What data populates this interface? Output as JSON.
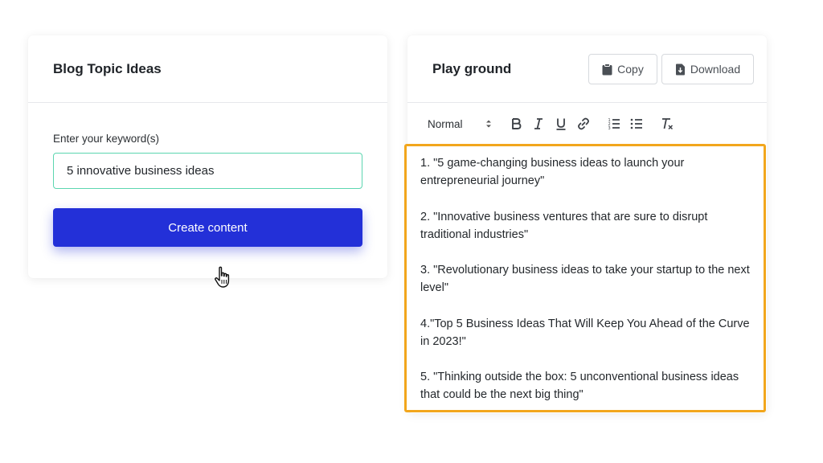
{
  "left_panel": {
    "title": "Blog Topic Ideas",
    "field_label": "Enter your keyword(s)",
    "keyword_value": "5 innovative business ideas",
    "create_button_label": "Create content"
  },
  "right_panel": {
    "title": "Play ground",
    "copy_label": "Copy",
    "download_label": "Download",
    "toolbar": {
      "format_selected": "Normal",
      "icons": [
        "bold-icon",
        "italic-icon",
        "underline-icon",
        "link-icon",
        "ordered-list-icon",
        "bullet-list-icon",
        "clear-format-icon"
      ]
    },
    "editor_items": [
      "1. \"5 game-changing business ideas to launch your entrepreneurial journey\"",
      "2. \"Innovative business ventures that are sure to disrupt traditional industries\"",
      "3. \"Revolutionary business ideas to take your startup to the next level\"",
      "4.\"Top 5 Business Ideas That Will Keep You Ahead of the Curve in 2023!\"",
      "5. \"Thinking outside the box: 5 unconventional business ideas that could be the next big thing\""
    ]
  },
  "colors": {
    "primary_button": "#2330d8",
    "input_border": "#5cd6b0",
    "editor_highlight": "#f2a61c"
  }
}
